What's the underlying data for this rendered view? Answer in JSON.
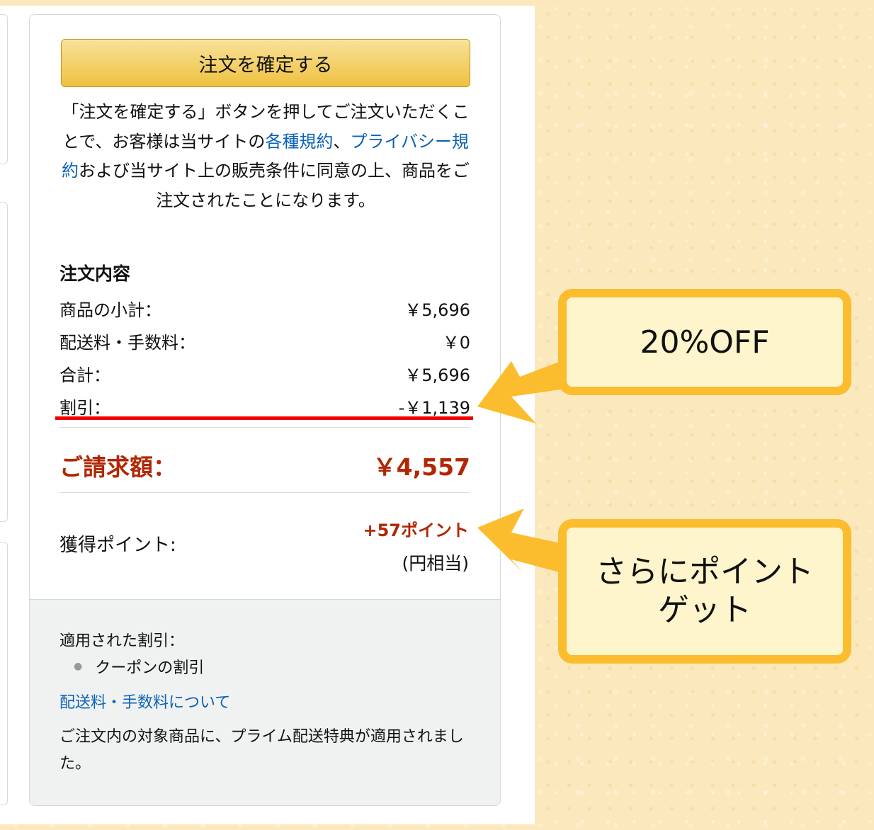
{
  "confirm_button": {
    "label": "注文を確定する"
  },
  "legal": {
    "text1": "「注文を確定する」ボタンを押してご注文いただくことで、お客様は当サイトの",
    "link1": "各種規約",
    "text2": "、",
    "link2": "プライバシー規約",
    "text3": "および当サイト上の販売条件に同意の上、商品をご注文されたことになります。"
  },
  "order_summary": {
    "title": "注文内容",
    "rows": [
      {
        "label": "商品の小計：",
        "value": "￥5,696"
      },
      {
        "label": "配送料・手数料：",
        "value": "￥0"
      },
      {
        "label": "合計：",
        "value": "￥5,696"
      },
      {
        "label": "割引：",
        "value": "-￥1,139"
      }
    ],
    "total_label": "ご請求額：",
    "total_value": "￥4,557",
    "points_label": "獲得ポイント:",
    "points_value": "+57ポイント",
    "points_note": "(円相当)"
  },
  "footer": {
    "applied_title": "適用された割引：",
    "applied_item": "クーポンの割引",
    "shipping_link": "配送料・手数料について",
    "prime_text": "ご注文内の対象商品に、プライム配送特典が適用されました。"
  },
  "callouts": {
    "discount": "20%OFF",
    "points_line1": "さらにポイント",
    "points_line2": "ゲット"
  },
  "colors": {
    "callout_border": "#fbbd2e",
    "callout_fill": "#fff5cc",
    "price_red": "#b12704",
    "link_blue": "#0a62b8",
    "button_gold": "#efc13f",
    "underline_red": "#ee0000"
  }
}
